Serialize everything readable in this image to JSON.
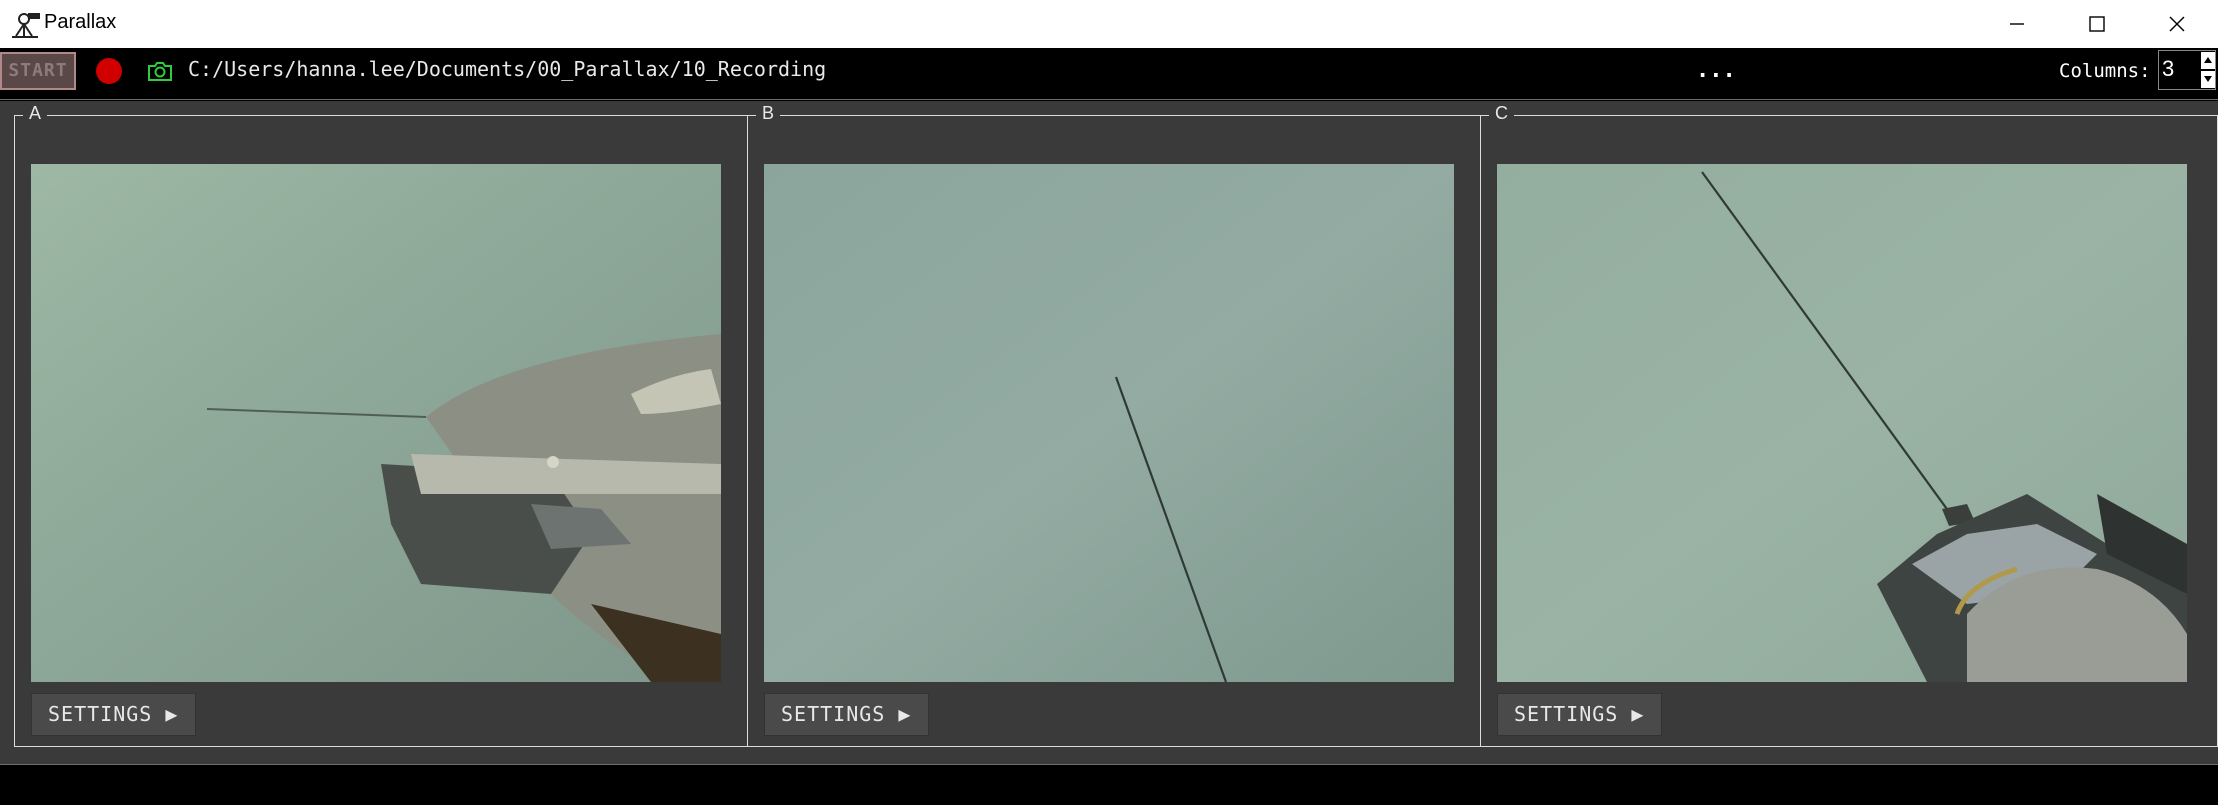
{
  "window": {
    "title": "Parallax"
  },
  "toolbar": {
    "start_label": "START",
    "path": "C:/Users/hanna.lee/Documents/00_Parallax/10_Recording",
    "more_label": "...",
    "columns_label": "Columns:",
    "columns_value": "3"
  },
  "panels": [
    {
      "label": "A",
      "settings_label": "SETTINGS ▶"
    },
    {
      "label": "B",
      "settings_label": "SETTINGS ▶"
    },
    {
      "label": "C",
      "settings_label": "SETTINGS ▶"
    }
  ],
  "colors": {
    "record": "#d10000",
    "snapshot": "#2ecc40",
    "panel_bg": "#3a3a3a",
    "camera_bg": "#8fa59a"
  },
  "icons": [
    "parallax-logo-icon",
    "record-icon",
    "camera-snapshot-icon",
    "minimize-icon",
    "maximize-icon",
    "close-icon"
  ]
}
